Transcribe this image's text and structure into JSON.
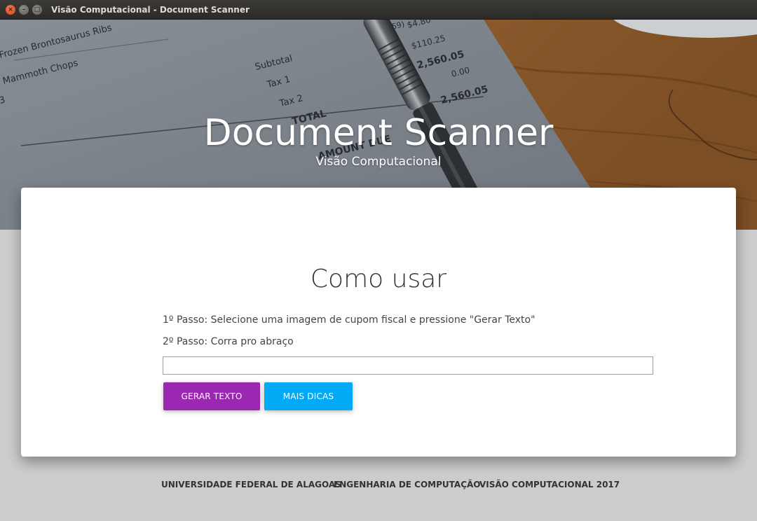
{
  "window": {
    "title": "Visão Computacional - Document Scanner",
    "close_glyph": "×",
    "minimize_glyph": "–",
    "maximize_glyph": "□"
  },
  "hero": {
    "title": "Document Scanner",
    "subtitle": "Visão Computacional",
    "background_image": "receipt-with-pen-on-wood",
    "receipt_lines": {
      "item1": "Frozen Brontosaurus Ribs",
      "item2": "Mammoth Chops",
      "price1": "$4.80",
      "price2": "$110.25",
      "big1": "2,560.05",
      "small_zero": "0.00",
      "big2": "2,560.05",
      "subtotal": "Subtotal",
      "tax1": "Tax 1",
      "tax2": "Tax 2",
      "total": "TOTAL",
      "amount": "AMOUNT DUE",
      "partial_num": "3",
      "partial_paren": "59)"
    }
  },
  "card": {
    "title": "Como usar",
    "step1": "1º Passo: Selecione uma imagem de cupom fiscal e pressione \"Gerar Texto\"",
    "step2": "2º Passo: Corra pro abraço",
    "file_input_value": "",
    "buttons": {
      "gerar": "GERAR TEXTO",
      "dicas": "MAIS DICAS"
    }
  },
  "footer": {
    "links": [
      "UNIVERSIDADE FEDERAL DE ALAGOAS",
      "ENGENHARIA DE COMPUTAÇÃO",
      "VISÃO COMPUTACIONAL 2017"
    ]
  },
  "colors": {
    "primary_button": "#9c27b0",
    "secondary_button": "#03a9f4",
    "page_background": "#cccccc"
  }
}
